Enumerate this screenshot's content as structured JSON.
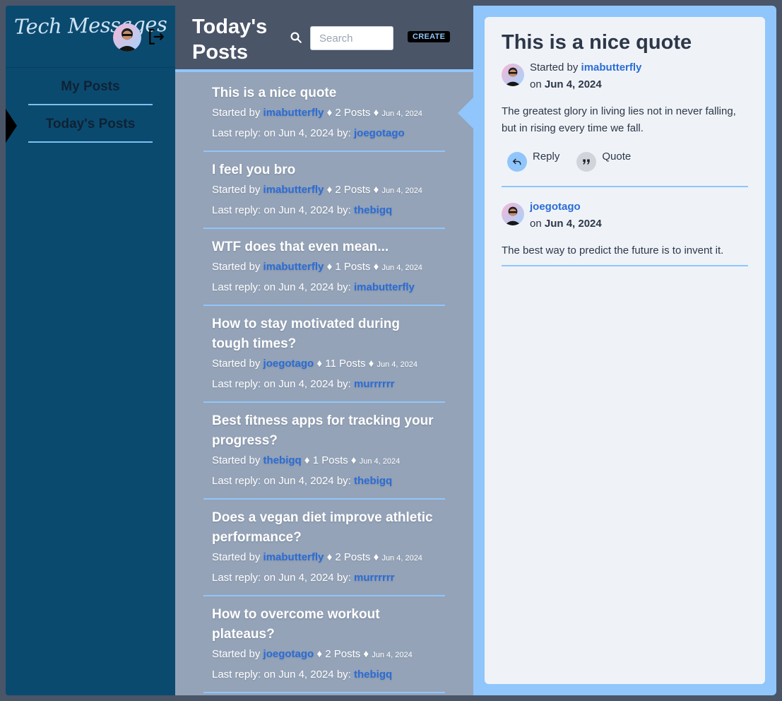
{
  "app": {
    "brand": "Tech Messages"
  },
  "sidebar": {
    "nav": [
      {
        "label": "My Posts"
      },
      {
        "label": "Today's Posts",
        "active": true
      }
    ]
  },
  "header": {
    "title": "Today's Posts",
    "search_placeholder": "Search",
    "create_label": "CREATE"
  },
  "labels": {
    "started_by": "Started by",
    "posts": "Posts",
    "diamond": "♦",
    "last_reply": "Last reply: on",
    "by": "by:"
  },
  "posts": [
    {
      "title": "This is a nice quote",
      "author": "imabutterfly",
      "count": "2",
      "date": "Jun 4, 2024",
      "last_reply_date": "Jun 4, 2024",
      "last_reply_by": "joegotago"
    },
    {
      "title": "I feel you bro",
      "author": "imabutterfly",
      "count": "2",
      "date": "Jun 4, 2024",
      "last_reply_date": "Jun 4, 2024",
      "last_reply_by": "thebigq"
    },
    {
      "title": "WTF does that even mean...",
      "author": "imabutterfly",
      "count": "1",
      "date": "Jun 4, 2024",
      "last_reply_date": "Jun 4, 2024",
      "last_reply_by": "imabutterfly"
    },
    {
      "title": "How to stay motivated during tough times?",
      "author": "joegotago",
      "count": "11",
      "date": "Jun 4, 2024",
      "last_reply_date": "Jun 4, 2024",
      "last_reply_by": "murrrrrr"
    },
    {
      "title": "Best fitness apps for tracking your progress?",
      "author": "thebigq",
      "count": "1",
      "date": "Jun 4, 2024",
      "last_reply_date": "Jun 4, 2024",
      "last_reply_by": "thebigq"
    },
    {
      "title": "Does a vegan diet improve athletic performance?",
      "author": "imabutterfly",
      "count": "2",
      "date": "Jun 4, 2024",
      "last_reply_date": "Jun 4, 2024",
      "last_reply_by": "murrrrrr"
    },
    {
      "title": "How to overcome workout plateaus?",
      "author": "joegotago",
      "count": "2",
      "date": "Jun 4, 2024",
      "last_reply_date": "Jun 4, 2024",
      "last_reply_by": "thebigq"
    }
  ],
  "detail": {
    "title": "This is a nice quote",
    "started_by_label": "Started by",
    "on_label": "on",
    "first": {
      "author": "imabutterfly",
      "date": "Jun 4, 2024",
      "body": "The greatest glory in living lies not in never falling, but in rising every time we fall."
    },
    "reply_label": "Reply",
    "quote_label": "Quote",
    "replies": [
      {
        "author": "joegotago",
        "date": "Jun 4, 2024",
        "body": "The best way to predict the future is to invent it."
      }
    ]
  },
  "icons": {
    "logout": "logout-icon",
    "search": "search-icon",
    "reply": "reply-arrow-icon",
    "quote": "quote-icon",
    "avatar": "user-avatar"
  },
  "colors": {
    "sidebar_bg": "#0b4a6f",
    "accent": "#90c6fb",
    "link": "#2b6cd6",
    "list_bg": "#94a3b8",
    "header_bg": "#4a5568"
  }
}
